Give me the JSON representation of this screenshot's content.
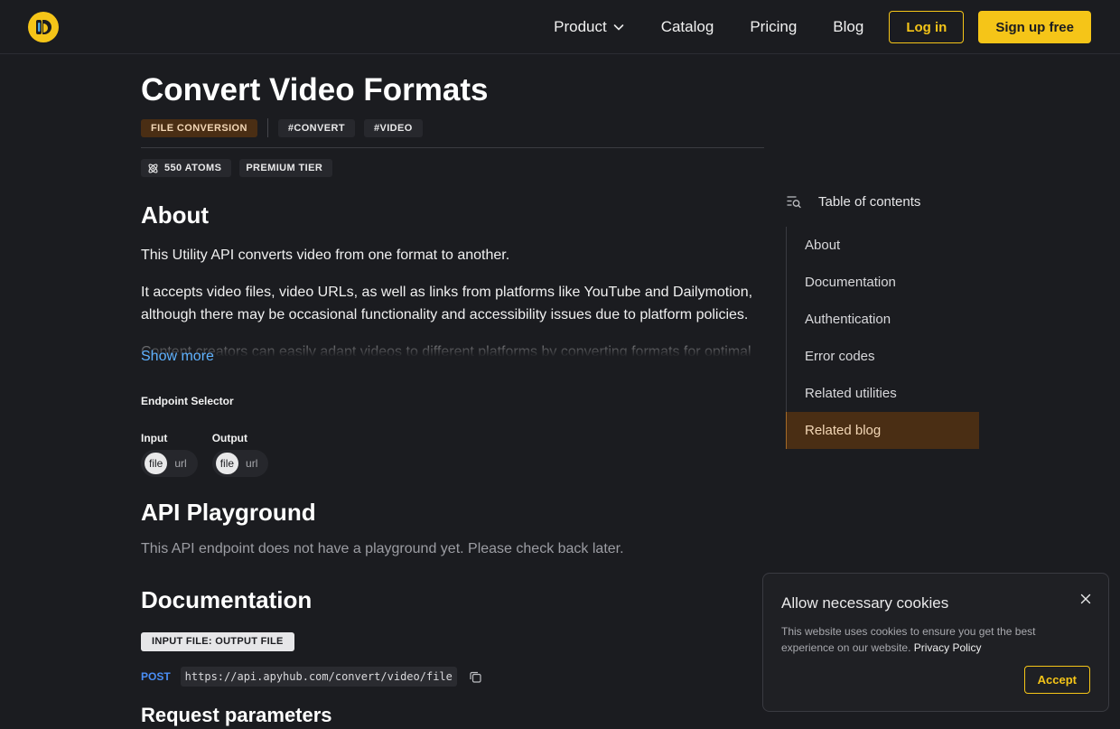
{
  "nav": {
    "links": [
      "Product",
      "Catalog",
      "Pricing",
      "Blog"
    ],
    "login": "Log in",
    "signup": "Sign up free"
  },
  "header": {
    "title": "Convert Video Formats",
    "category": "FILE CONVERSION",
    "tags": [
      "#CONVERT",
      "#VIDEO"
    ],
    "atoms": "550 ATOMS",
    "tier": "PREMIUM TIER"
  },
  "about": {
    "heading": "About",
    "paragraphs": [
      "This Utility API converts video from one format to another.",
      "It accepts video files, video URLs, as well as links from platforms like YouTube and Dailymotion, although there may be occasional functionality and accessibility issues due to platform policies.",
      "Content creators can easily adapt videos to different platforms by converting formats for optimal compatibility and reach. It is ideal for media content creators. Businesses benefit from"
    ],
    "show_more": "Show more"
  },
  "endpoint_selector": {
    "title": "Endpoint Selector",
    "input_label": "Input",
    "output_label": "Output",
    "options": [
      "file",
      "url"
    ]
  },
  "playground": {
    "heading": "API Playground",
    "note": "This API endpoint does not have a playground yet. Please check back later."
  },
  "documentation": {
    "heading": "Documentation",
    "io_badge": "INPUT FILE: OUTPUT FILE",
    "method": "POST",
    "url": "https://api.apyhub.com/convert/video/file",
    "next_heading": "Request parameters"
  },
  "toc": {
    "title": "Table of contents",
    "items": [
      "About",
      "Documentation",
      "Authentication",
      "Error codes",
      "Related utilities",
      "Related blog"
    ],
    "active_index": 5
  },
  "cookie": {
    "title": "Allow necessary cookies",
    "text": "This website uses cookies to ensure you get the best experience on our website.",
    "link": "Privacy Policy",
    "accept": "Accept"
  },
  "colors": {
    "accent": "#f5c518",
    "category_bg": "#4a2e14",
    "link": "#5fb2ff",
    "method": "#4a8ef5"
  }
}
